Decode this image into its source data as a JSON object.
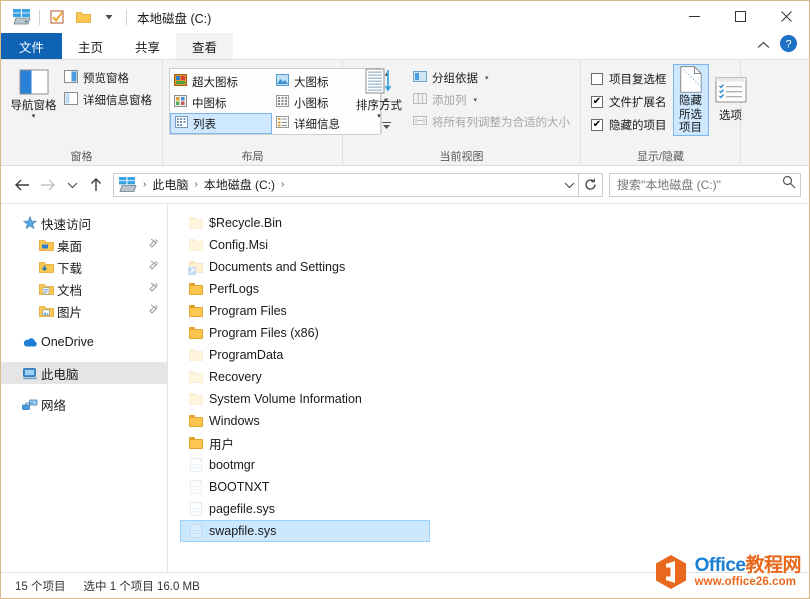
{
  "window": {
    "title": "本地磁盘 (C:)",
    "quick_access": [
      {
        "name": "drive-icon",
        "glyph": "drive"
      },
      {
        "name": "properties-icon",
        "glyph": "properties"
      },
      {
        "name": "new-folder-icon",
        "glyph": "folder"
      },
      {
        "name": "customize-qat-dropdown",
        "glyph": "caret"
      }
    ],
    "controls": {
      "minimize": "—",
      "maximize": "□",
      "close": "✕"
    }
  },
  "tabs": {
    "file": "文件",
    "items": [
      {
        "label": "主页",
        "active": false
      },
      {
        "label": "共享",
        "active": false
      },
      {
        "label": "查看",
        "active": true
      }
    ],
    "collapse_ribbon": "⌃",
    "help": "?"
  },
  "ribbon": {
    "groups": [
      {
        "label": "窗格",
        "big_button": {
          "label": "导航窗格",
          "caret": "▾"
        },
        "small_items": [
          {
            "label": "预览窗格",
            "disabled": false
          },
          {
            "label": "详细信息窗格",
            "disabled": false
          }
        ]
      },
      {
        "label": "布局",
        "views": [
          {
            "label": "超大图标",
            "selected": false
          },
          {
            "label": "大图标",
            "selected": false
          },
          {
            "label": "中图标",
            "selected": false
          },
          {
            "label": "小图标",
            "selected": false
          },
          {
            "label": "列表",
            "selected": true
          },
          {
            "label": "详细信息",
            "selected": false
          }
        ],
        "scroll": {
          "up": "▴",
          "down": "▾",
          "more": "▾"
        }
      },
      {
        "label": "当前视图",
        "big_button": {
          "label": "排序方式",
          "caret": "▾"
        },
        "small_items": [
          {
            "label": "分组依据",
            "disabled": false,
            "caret": "▾"
          },
          {
            "label": "添加列",
            "disabled": true,
            "caret": "▾"
          },
          {
            "label": "将所有列调整为合适的大小",
            "disabled": true,
            "caret": ""
          }
        ]
      },
      {
        "label": "显示/隐藏",
        "checkboxes": [
          {
            "label": "项目复选框",
            "checked": false
          },
          {
            "label": "文件扩展名",
            "checked": true
          },
          {
            "label": "隐藏的项目",
            "checked": true
          }
        ],
        "toggle_button": {
          "line1": "隐藏",
          "line2": "所选项目",
          "active": true
        },
        "options_button": {
          "label": "选项"
        }
      }
    ]
  },
  "addressbar": {
    "back": "←",
    "forward": "→",
    "recent": "⌄",
    "up": "↑",
    "breadcrumbs": [
      {
        "label": "",
        "icon": "pc-drive-icon"
      },
      {
        "label": "此电脑"
      },
      {
        "label": "本地磁盘 (C:)"
      }
    ],
    "separator": "›",
    "dropdown": "⌄",
    "refresh": "↻",
    "search_placeholder": "搜索\"本地磁盘 (C:)\"",
    "search_value": ""
  },
  "sidebar": {
    "sections": [
      {
        "label": "快速访问",
        "icon": "star-icon",
        "level": 0,
        "selected": false,
        "pinned": false
      },
      {
        "label": "桌面",
        "icon": "desktop-folder-icon",
        "level": 1,
        "selected": false,
        "pinned": true
      },
      {
        "label": "下载",
        "icon": "downloads-folder-icon",
        "level": 1,
        "selected": false,
        "pinned": true
      },
      {
        "label": "文档",
        "icon": "documents-folder-icon",
        "level": 1,
        "selected": false,
        "pinned": true
      },
      {
        "label": "图片",
        "icon": "pictures-folder-icon",
        "level": 1,
        "selected": false,
        "pinned": true
      },
      {
        "label": "OneDrive",
        "icon": "onedrive-cloud-icon",
        "level": 0,
        "selected": false,
        "pinned": false,
        "gap_before": true
      },
      {
        "label": "此电脑",
        "icon": "this-pc-icon",
        "level": 0,
        "selected": true,
        "pinned": false,
        "gap_before": true
      },
      {
        "label": "网络",
        "icon": "network-icon",
        "level": 0,
        "selected": false,
        "pinned": false,
        "gap_before": true
      }
    ]
  },
  "files": [
    {
      "name": "$Recycle.Bin",
      "type": "folder",
      "hidden": true,
      "selected": false
    },
    {
      "name": "Config.Msi",
      "type": "folder",
      "hidden": true,
      "selected": false
    },
    {
      "name": "Documents and Settings",
      "type": "junction",
      "hidden": true,
      "selected": false
    },
    {
      "name": "PerfLogs",
      "type": "folder",
      "hidden": false,
      "selected": false
    },
    {
      "name": "Program Files",
      "type": "folder",
      "hidden": false,
      "selected": false
    },
    {
      "name": "Program Files (x86)",
      "type": "folder",
      "hidden": false,
      "selected": false
    },
    {
      "name": "ProgramData",
      "type": "folder",
      "hidden": true,
      "selected": false
    },
    {
      "name": "Recovery",
      "type": "folder",
      "hidden": true,
      "selected": false
    },
    {
      "name": "System Volume Information",
      "type": "folder",
      "hidden": true,
      "selected": false
    },
    {
      "name": "Windows",
      "type": "folder",
      "hidden": false,
      "selected": false
    },
    {
      "name": "用户",
      "type": "folder",
      "hidden": false,
      "selected": false
    },
    {
      "name": "bootmgr",
      "type": "file",
      "hidden": true,
      "selected": false
    },
    {
      "name": "BOOTNXT",
      "type": "file",
      "hidden": true,
      "selected": false
    },
    {
      "name": "pagefile.sys",
      "type": "file",
      "hidden": true,
      "selected": false
    },
    {
      "name": "swapfile.sys",
      "type": "file",
      "hidden": true,
      "selected": true
    }
  ],
  "statusbar": {
    "item_count": "15 个项目",
    "selection": "选中 1 个项目  16.0 MB"
  },
  "watermark": {
    "brand_en": "Office",
    "brand_cn": "教程网",
    "url": "www.office26.com"
  },
  "colors": {
    "file_tab_blue": "#0e63b4",
    "selection_blue": "#cce8ff",
    "ribbon_bg": "#f3f3f3",
    "folder_yellow": "#fcc751",
    "watermark_blue": "#1b7fd4",
    "watermark_orange": "#e8681d"
  }
}
